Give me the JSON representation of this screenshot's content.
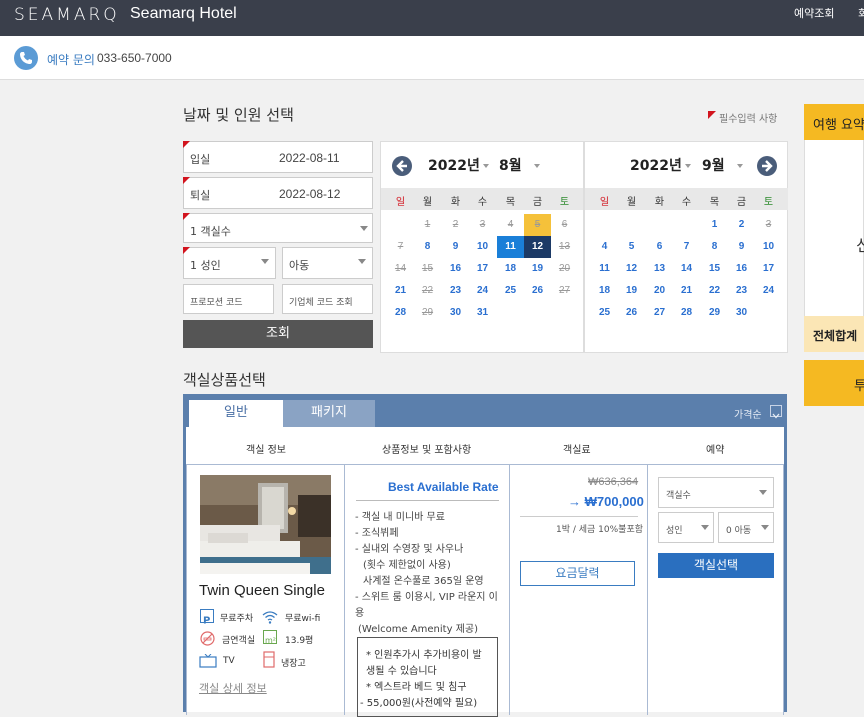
{
  "header": {
    "logo": "SEAMARQ",
    "hotel_name": "Seamarq Hotel",
    "nav": [
      "예약조회",
      "회"
    ]
  },
  "contact": {
    "label": "예약 문의",
    "phone": "033-650-7000"
  },
  "search": {
    "title": "날짜 및 인원 선택",
    "required_note": "필수입력 사항",
    "checkin_label": "입실",
    "checkin_value": "2022-08-11",
    "checkout_label": "퇴실",
    "checkout_value": "2022-08-12",
    "rooms": "1 객실수",
    "adults": "1 성인",
    "children": "아동",
    "promo_placeholder": "프로모션 코드",
    "corp_placeholder": "기업체 코드 조회",
    "search_button": "조회"
  },
  "calendar": {
    "dow": [
      "일",
      "월",
      "화",
      "수",
      "목",
      "금",
      "토"
    ],
    "left": {
      "year": "2022년",
      "month": "8월",
      "days": [
        "1",
        "2",
        "3",
        "4",
        "5",
        "6",
        "7",
        "8",
        "9",
        "10",
        "11",
        "12",
        "13",
        "14",
        "15",
        "16",
        "17",
        "18",
        "19",
        "20",
        "21",
        "22",
        "23",
        "24",
        "25",
        "26",
        "27",
        "28",
        "29",
        "30",
        "31"
      ]
    },
    "right": {
      "year": "2022년",
      "month": "9월",
      "days": [
        "1",
        "2",
        "3",
        "4",
        "5",
        "6",
        "7",
        "8",
        "9",
        "10",
        "11",
        "12",
        "13",
        "14",
        "15",
        "16",
        "17",
        "18",
        "19",
        "20",
        "21",
        "22",
        "23",
        "24",
        "25",
        "26",
        "27",
        "28",
        "29",
        "30"
      ]
    }
  },
  "sidebar": {
    "summary_title": "여행 요약",
    "partial_char": "신",
    "total_label": "전체합계",
    "button": "투"
  },
  "products": {
    "title": "객실상품선택",
    "tabs": [
      "일반",
      "패키지"
    ],
    "sort": "가격순",
    "columns": [
      "객실 정보",
      "상품정보 및 포함사항",
      "객실료",
      "예약"
    ],
    "room": {
      "name": "Twin Queen Single",
      "amenities": [
        "무료주차",
        "무료wi-fi",
        "금연객실",
        "13.9평",
        "TV",
        "냉장고"
      ],
      "detail_link": "객실 상세 정보"
    },
    "rate": {
      "name": "Best Available Rate",
      "inclusions": [
        "- 객실 내 미니바 무료",
        "- 조식뷔페",
        "- 실내외 수영장 및 사우나",
        "  (횟수 제한없이 사용)",
        "  사계절 온수풀로 365일 운영",
        "- 스위트 룸 이용시, VIP 라운지 이",
        "용",
        "  (Welcome Amenity 제공)"
      ],
      "notes": [
        "* 인원추가시 추가비용이 발",
        "  생될 수 있습니다",
        "* 엑스트라 베드 및 침구",
        "- 55,000원(사전예약 필요)"
      ]
    },
    "price": {
      "original": "₩636,364",
      "final": "→ ₩700,000",
      "tax_note": "1박 / 세금 10%불포함",
      "calendar_button": "요금달력"
    },
    "booking": {
      "rooms": "객실수",
      "adults": "성인",
      "children": "0 아동",
      "button": "객실선택"
    }
  }
}
